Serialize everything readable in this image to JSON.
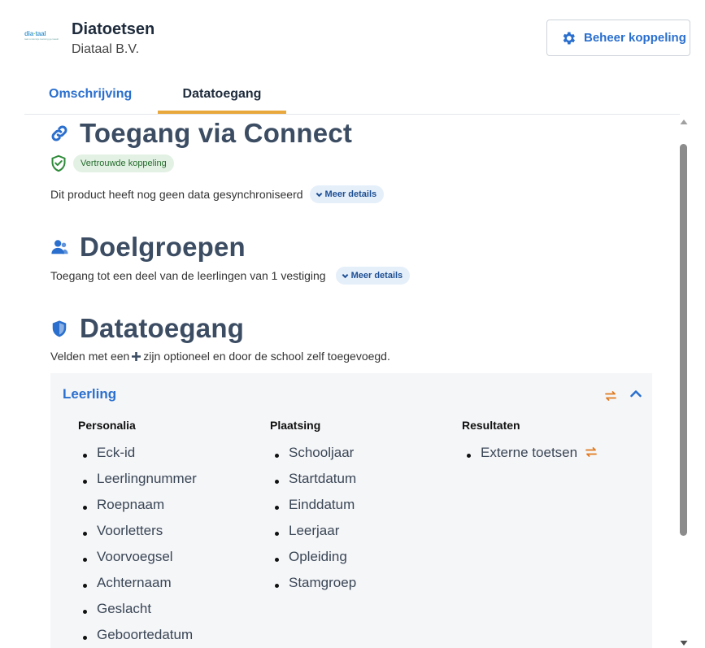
{
  "header": {
    "logo_text_1": "dia",
    "logo_text_2": "taal",
    "logo_tagline": "taal onderwijs toetsing gemaakt",
    "app_title": "Diatoetsen",
    "app_subtitle": "Diataal B.V.",
    "manage_button": "Beheer koppeling"
  },
  "tabs": [
    {
      "label": "Omschrijving",
      "active": false
    },
    {
      "label": "Datatoegang",
      "active": true
    }
  ],
  "connect": {
    "title": "Toegang via Connect",
    "trust_badge": "Vertrouwde koppeling",
    "sync_text": "Dit product heeft nog geen data gesynchroniseerd",
    "more_details": "Meer details"
  },
  "doelgroepen": {
    "title": "Doelgroepen",
    "text": "Toegang tot een deel van de leerlingen van 1 vestiging",
    "more_details": "Meer details"
  },
  "datatoegang": {
    "title": "Datatoegang",
    "note_before": "Velden met een",
    "note_after": "zijn optioneel en door de school zelf toegevoegd."
  },
  "panel": {
    "title": "Leerling",
    "columns": [
      {
        "heading": "Personalia",
        "items": [
          "Eck-id",
          "Leerlingnummer",
          "Roepnaam",
          "Voorletters",
          "Voorvoegsel",
          "Achternaam",
          "Geslacht",
          "Geboortedatum"
        ]
      },
      {
        "heading": "Plaatsing",
        "items": [
          "Schooljaar",
          "Startdatum",
          "Einddatum",
          "Leerjaar",
          "Opleiding",
          "Stamgroep"
        ]
      },
      {
        "heading": "Resultaten",
        "items": [
          "Externe toetsen"
        ]
      }
    ]
  },
  "colors": {
    "primary_blue": "#2a6fce",
    "heading_slate": "#3c4d63",
    "tab_underline": "#e9a83c",
    "sync_orange": "#e07a1f",
    "trust_green": "#2f8a3a"
  }
}
